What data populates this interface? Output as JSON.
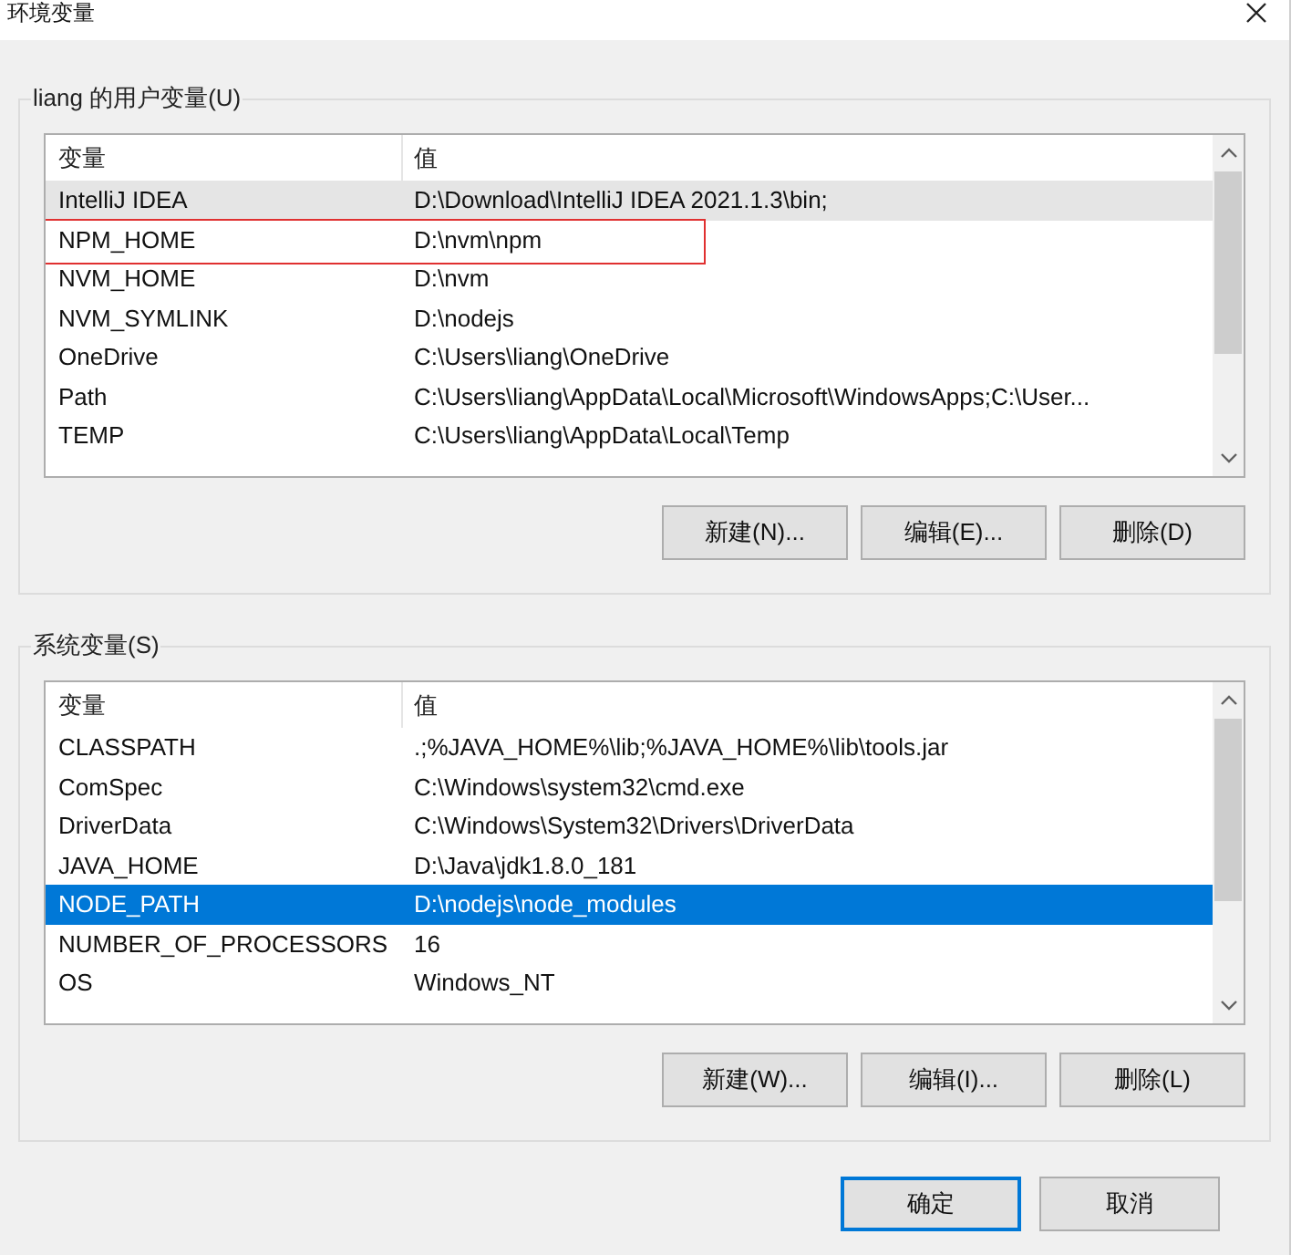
{
  "window": {
    "title": "环境变量"
  },
  "user_variables": {
    "title": "liang 的用户变量(U)",
    "focused": false,
    "columns": [
      "变量",
      "值"
    ],
    "rows": [
      {
        "name": "IntelliJ IDEA",
        "value": "D:\\Download\\IntelliJ IDEA 2021.1.3\\bin;",
        "selected": true,
        "highlighted": false
      },
      {
        "name": "NPM_HOME",
        "value": "D:\\nvm\\npm",
        "selected": false,
        "highlighted": true
      },
      {
        "name": "NVM_HOME",
        "value": "D:\\nvm",
        "selected": false,
        "highlighted": false
      },
      {
        "name": "NVM_SYMLINK",
        "value": "D:\\nodejs",
        "selected": false,
        "highlighted": false
      },
      {
        "name": "OneDrive",
        "value": "C:\\Users\\liang\\OneDrive",
        "selected": false,
        "highlighted": false
      },
      {
        "name": "Path",
        "value": "C:\\Users\\liang\\AppData\\Local\\Microsoft\\WindowsApps;C:\\User...",
        "selected": false,
        "highlighted": false
      },
      {
        "name": "TEMP",
        "value": "C:\\Users\\liang\\AppData\\Local\\Temp",
        "selected": false,
        "highlighted": false
      }
    ],
    "buttons": [
      "新建(N)...",
      "编辑(E)...",
      "删除(D)"
    ]
  },
  "system_variables": {
    "title": "系统变量(S)",
    "focused": true,
    "columns": [
      "变量",
      "值"
    ],
    "rows": [
      {
        "name": "CLASSPATH",
        "value": ".;%JAVA_HOME%\\lib;%JAVA_HOME%\\lib\\tools.jar",
        "selected": false,
        "highlighted": false
      },
      {
        "name": "ComSpec",
        "value": "C:\\Windows\\system32\\cmd.exe",
        "selected": false,
        "highlighted": false
      },
      {
        "name": "DriverData",
        "value": "C:\\Windows\\System32\\Drivers\\DriverData",
        "selected": false,
        "highlighted": false
      },
      {
        "name": "JAVA_HOME",
        "value": "D:\\Java\\jdk1.8.0_181",
        "selected": false,
        "highlighted": false
      },
      {
        "name": "NODE_PATH",
        "value": "D:\\nodejs\\node_modules",
        "selected": true,
        "highlighted": false
      },
      {
        "name": "NUMBER_OF_PROCESSORS",
        "value": "16",
        "selected": false,
        "highlighted": false
      },
      {
        "name": "OS",
        "value": "Windows_NT",
        "selected": false,
        "highlighted": false
      }
    ],
    "buttons": [
      "新建(W)...",
      "编辑(I)...",
      "删除(L)"
    ]
  },
  "dialog_buttons": [
    {
      "label": "确定",
      "default": true
    },
    {
      "label": "取消",
      "default": false
    }
  ]
}
